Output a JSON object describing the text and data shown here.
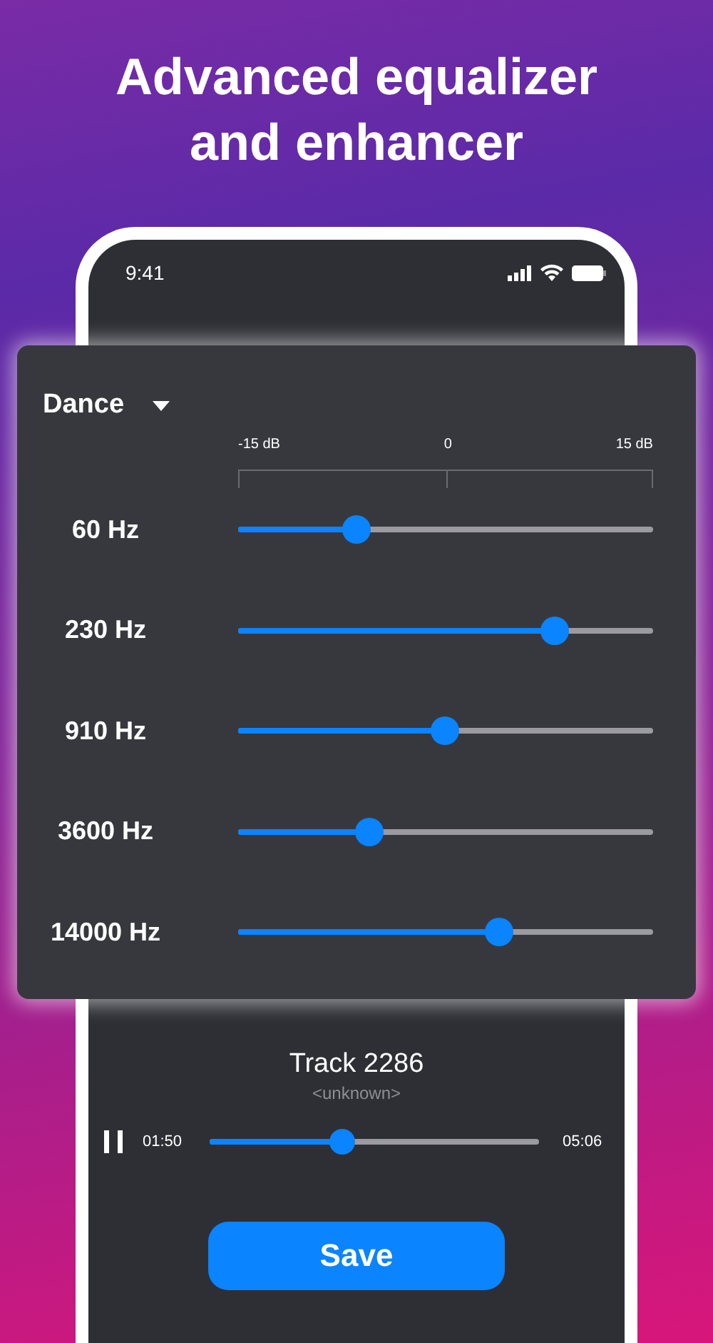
{
  "headline": "Advanced equalizer and enhancer",
  "status_bar": {
    "time": "9:41"
  },
  "equalizer": {
    "preset": "Dance",
    "scale": [
      "-15 dB",
      "0",
      "15 dB"
    ],
    "bands": [
      {
        "label": "60 Hz",
        "level": 0.285
      },
      {
        "label": "230 Hz",
        "level": 0.763
      },
      {
        "label": "910 Hz",
        "level": 0.498
      },
      {
        "label": "3600 Hz",
        "level": 0.316
      },
      {
        "label": "14000 Hz",
        "level": 0.629
      }
    ]
  },
  "player": {
    "title": "Track 2286",
    "artist": "<unknown>",
    "playing": true,
    "elapsed": "01:50",
    "level": 0.403,
    "duration": "05:06"
  },
  "save_button": "Save"
}
